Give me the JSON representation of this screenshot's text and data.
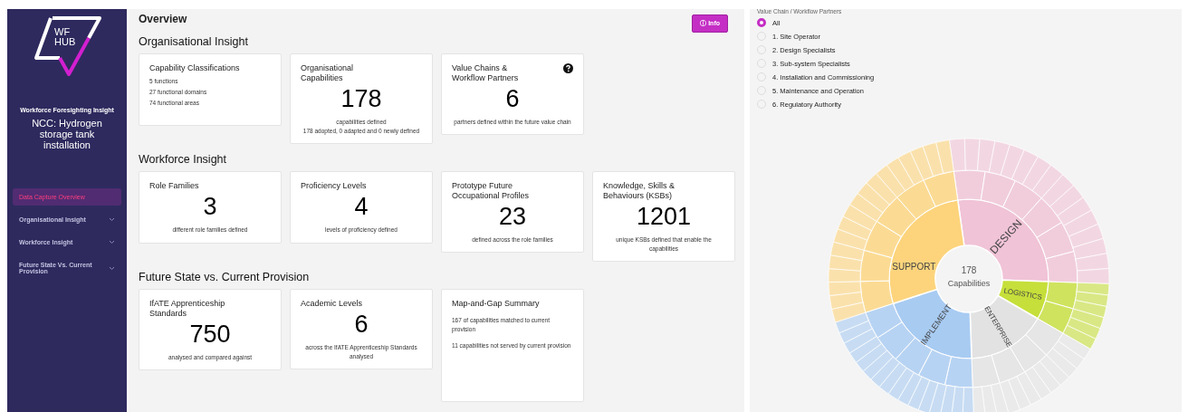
{
  "sidebar": {
    "logo": {
      "line_1": "WF",
      "line_2": "HUB"
    },
    "subtitle": "Workforce Foresighting Insight",
    "project": "NCC: Hydrogen storage tank installation",
    "items": [
      {
        "label": "Data Capture Overview",
        "selected": true,
        "kind": "link"
      },
      {
        "label": "Organisational Insight",
        "selected": false,
        "kind": "group"
      },
      {
        "label": "Workforce Insight",
        "selected": false,
        "kind": "group"
      },
      {
        "label": "Future State Vs. Current Provision",
        "selected": false,
        "kind": "group"
      }
    ]
  },
  "main": {
    "title": "Overview",
    "info_button": {
      "icon": "ⓘ",
      "label": "Info"
    },
    "sections": [
      {
        "heading": "Organisational Insight",
        "cards": [
          {
            "kind": "list",
            "title": "Capability Classifications",
            "lines": [
              "5 functions",
              "27 functional domains",
              "74 functional areas"
            ]
          },
          {
            "kind": "stat",
            "title": "Organisational Capabilities",
            "value": "178",
            "caption": "capabilities defined",
            "caption_2": "178 adopted, 0 adapted and 0 newly defined"
          },
          {
            "kind": "stat",
            "title": "Value Chains & Workflow Partners",
            "help": true,
            "value": "6",
            "caption": "partners defined within the future value chain"
          }
        ]
      },
      {
        "heading": "Workforce Insight",
        "cards": [
          {
            "kind": "stat",
            "title": "Role Families",
            "value": "3",
            "caption": "different role families defined"
          },
          {
            "kind": "stat",
            "title": "Proficiency Levels",
            "value": "4",
            "caption": "levels of proficiency defined"
          },
          {
            "kind": "stat",
            "title": "Prototype Future Occupational Profiles",
            "value": "23",
            "caption": "defined across the role families"
          },
          {
            "kind": "stat",
            "title": "Knowledge, Skills & Behaviours (KSBs)",
            "value": "1201",
            "caption": "unique KSBs defined that enable the capabilities"
          }
        ]
      },
      {
        "heading": "Future State vs. Current Provision",
        "cards": [
          {
            "kind": "stat",
            "title": "IfATE Apprenticeship Standards",
            "value": "750",
            "caption": "analysed and compared against"
          },
          {
            "kind": "stat",
            "title": "Academic Levels",
            "value": "6",
            "caption": "across the IfATE Apprenticeship Standards analysed"
          },
          {
            "kind": "list",
            "title": "Map-and-Gap Summary",
            "tall": true,
            "lines": [
              "167 of capabilities matched to current provision",
              "11 capabilities not served by current provision"
            ]
          }
        ]
      }
    ]
  },
  "partners": {
    "heading": "Value Chain / Workflow Partners",
    "options": [
      {
        "label": "All",
        "selected": true
      },
      {
        "label": "1. Site Operator",
        "selected": false
      },
      {
        "label": "2. Design Specialists",
        "selected": false
      },
      {
        "label": "3. Sub-system Specialists",
        "selected": false
      },
      {
        "label": "4. Installation and Commissioning",
        "selected": false
      },
      {
        "label": "5. Maintenance and Operation",
        "selected": false
      },
      {
        "label": "6. Regulatory Authority",
        "selected": false
      }
    ]
  },
  "sunburst": {
    "center_value": "178",
    "center_label": "Capabilities",
    "functions": [
      {
        "label": "DESIGN",
        "color": "#f0c3d6"
      },
      {
        "label": "LOGISTICS",
        "color": "#c6df3a"
      },
      {
        "label": "ENTERPRISE",
        "color": "#e2e2e2"
      },
      {
        "label": "IMPLEMENT",
        "color": "#a8cbf2"
      },
      {
        "label": "SUPPORT",
        "color": "#fdd47c"
      }
    ]
  }
}
